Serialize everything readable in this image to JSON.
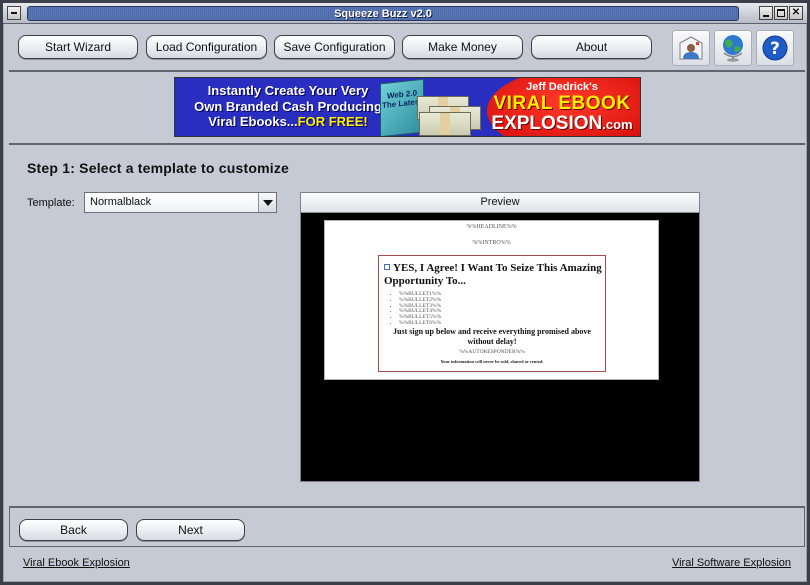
{
  "window": {
    "title": "Squeeze Buzz v2.0",
    "controls": [
      "minimize",
      "maximize",
      "close"
    ]
  },
  "toolbar": {
    "buttons": [
      {
        "label": "Start Wizard"
      },
      {
        "label": "Load Configuration"
      },
      {
        "label": "Save Configuration"
      },
      {
        "label": "Make Money"
      },
      {
        "label": "About"
      }
    ],
    "icon_buttons": [
      {
        "icon": "contact-icon",
        "tooltip": ""
      },
      {
        "icon": "globe-icon",
        "tooltip": ""
      },
      {
        "icon": "help-icon",
        "tooltip": ""
      }
    ]
  },
  "banner": {
    "left_line1": "Instantly Create Your Very",
    "left_line2": "Own Branded Cash Producing",
    "left_line3": "Viral Ebooks...",
    "left_free": "FOR FREE!",
    "book_text": "Web 2.0 The Latest",
    "right_line1": "Jeff Dedrick's",
    "right_line2": "VIRAL EBOOK",
    "right_line3": "EXPLOSION",
    "right_suffix": ".com"
  },
  "step": {
    "title": "Step 1: Select a template to customize",
    "template_label": "Template:",
    "template_value": "Normalblack"
  },
  "preview": {
    "header": "Preview",
    "headline_placeholder": "%%HEADLINE%%",
    "intro_placeholder": "%%INTRO%%",
    "optin_heading": "YES, I Agree! I Want To Seize This Amazing Opportunity To...",
    "bullets": [
      "%%BULLET1%%",
      "%%BULLET2%%",
      "%%BULLET3%%",
      "%%BULLET4%%",
      "%%BULLET5%%",
      "%%BULLET6%%"
    ],
    "cta": "Just sign up below and receive everything promised above without delay!",
    "autoresponder_placeholder": "%%AUTORESPONDER%%",
    "privacy": "Your information will never be sold, shared or rented."
  },
  "navigation": {
    "back_label": "Back",
    "next_label": "Next"
  },
  "footer": {
    "left_link": "Viral Ebook Explosion",
    "right_link": "Viral Software Explosion"
  }
}
